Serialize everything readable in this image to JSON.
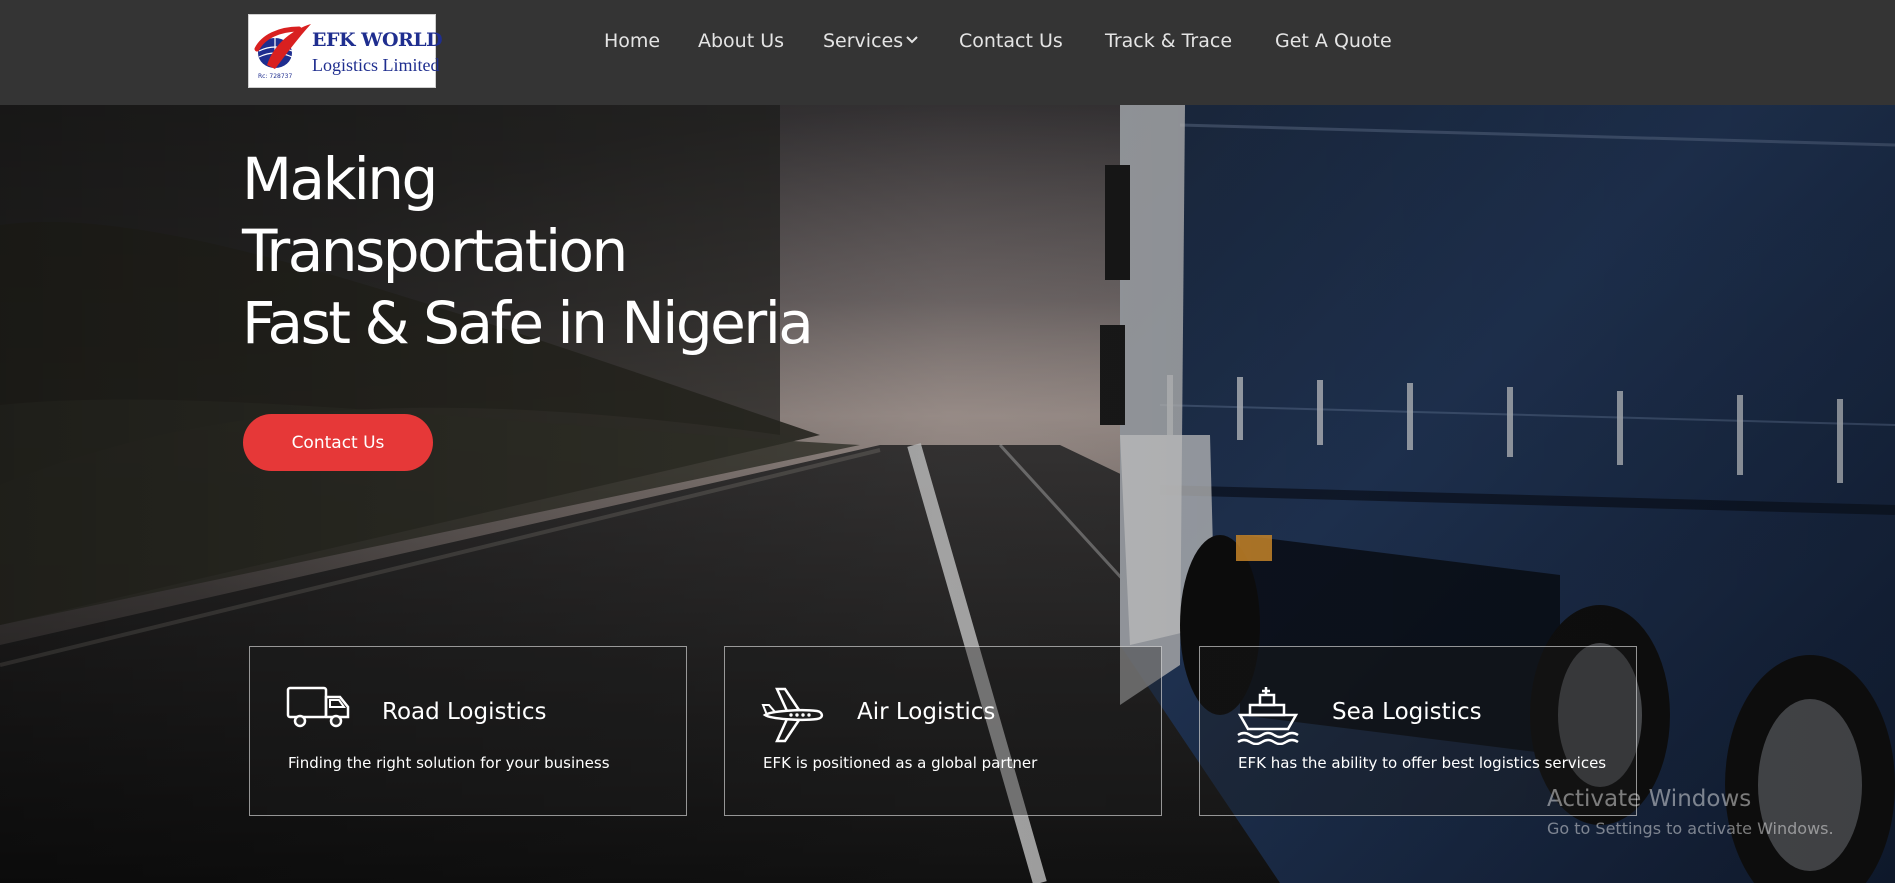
{
  "header": {
    "logo": {
      "title_line1": "EFK WORLD",
      "title_line2": "Logistics Limited",
      "reg_number": "Rc: 728737"
    },
    "nav": [
      {
        "label": "Home"
      },
      {
        "label": "About Us"
      },
      {
        "label": "Services"
      },
      {
        "label": "Contact Us"
      },
      {
        "label": "Track & Trace"
      },
      {
        "label": "Get A Quote"
      }
    ]
  },
  "hero": {
    "headline_lines": [
      "Making",
      "Transportation",
      "Fast & Safe in Nigeria"
    ],
    "cta_label": "Contact Us",
    "cta_color": "#e63838"
  },
  "services": [
    {
      "icon": "truck-icon",
      "title": "Road Logistics",
      "description": "Finding the right solution for your business"
    },
    {
      "icon": "airplane-icon",
      "title": "Air Logistics",
      "description": "EFK is positioned as a global partner"
    },
    {
      "icon": "ship-icon",
      "title": "Sea Logistics",
      "description": "EFK has the ability to offer best logistics services"
    }
  ],
  "watermark": {
    "title": "Activate Windows",
    "subtitle": "Go to Settings to activate Windows."
  }
}
